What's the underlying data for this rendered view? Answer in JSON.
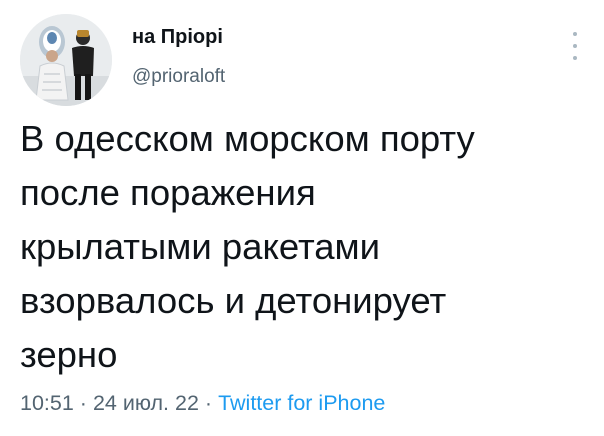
{
  "tweet": {
    "author": {
      "display_name": "на Пріорі",
      "handle": "@prioraloft",
      "avatar_icon": "avatar-photo"
    },
    "more_icon": "more-vertical-icon",
    "text": "В одесском морском порту\nпосле поражения\nкрылатыми ракетами\nвзорвалось и детонирует\nзерно",
    "time": "10:51",
    "date": "24 июл. 22",
    "separator": "·",
    "source": "Twitter for iPhone"
  },
  "colors": {
    "text": "#0f1419",
    "secondary": "#536471",
    "link": "#1d9bf0"
  }
}
